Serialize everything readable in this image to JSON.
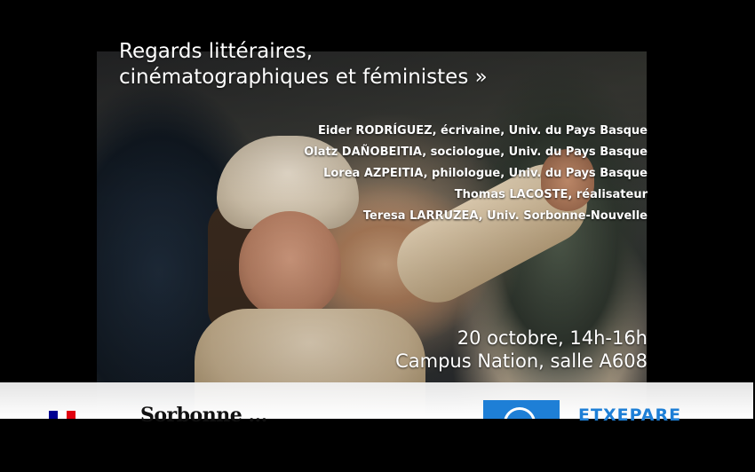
{
  "poster": {
    "title_line1": "Regards littéraires,",
    "title_line2": "cinématographiques et féministes »",
    "speakers": [
      "Eider RODRÍGUEZ, écrivaine, Univ. du Pays Basque",
      "Olatz DAÑOBEITIA, sociologue, Univ. du Pays Basque",
      "Lorea AZPEITIA, philologue, Univ. du Pays Basque",
      "Thomas LACOSTE, réalisateur",
      "Teresa LARRUZEA, Univ. Sorbonne-Nouvelle"
    ],
    "date": "20 octobre, 14h-16h",
    "place": "Campus Nation, salle A608"
  },
  "logos": {
    "left_logo": "Sorbonne ...",
    "right_logo": "ETXEPARE",
    "republique_colors": [
      "#000091",
      "#ffffff",
      "#e1000f"
    ],
    "etxepare_color": "#1e7fd6"
  }
}
